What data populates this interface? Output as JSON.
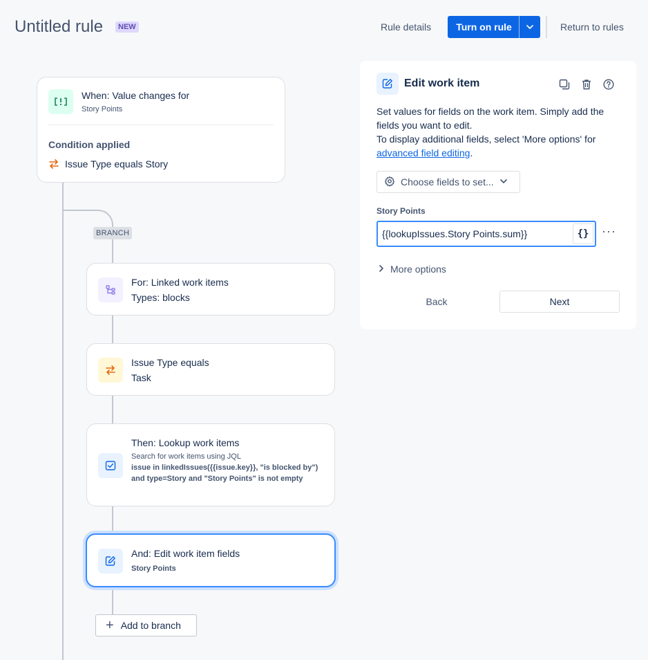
{
  "header": {
    "title": "Untitled rule",
    "badge": "NEW",
    "rule_details": "Rule details",
    "turn_on": "Turn on rule",
    "return": "Return to rules"
  },
  "trigger": {
    "title": "When: Value changes for",
    "subtitle": "Story Points",
    "condition_heading": "Condition applied",
    "condition_text": "Issue Type equals Story"
  },
  "branch_tag": "BRANCH",
  "steps": [
    {
      "title": "For: Linked work items",
      "subtitle": "Types: blocks",
      "icon": "branch-icon"
    },
    {
      "title": "Issue Type equals",
      "subtitle": "Task",
      "icon": "swap-icon"
    },
    {
      "title": "Then: Lookup work items",
      "subtitle": "Search for work items using JQL",
      "detail": "issue in linkedIssues({{issue.key}}, \"is blocked by\") and type=Story and \"Story Points\" is not empty",
      "icon": "lookup-icon"
    },
    {
      "title": "And: Edit work item fields",
      "subtitle": "Story Points",
      "icon": "edit-icon"
    }
  ],
  "add_branch": "Add to branch",
  "panel": {
    "title": "Edit work item",
    "desc1": "Set values for fields on the work item. Simply add the fields you want to edit.",
    "desc2": "To display additional fields, select 'More options' for",
    "link": "advanced field editing",
    "desc_end": ".",
    "choose_fields": "Choose fields to set...",
    "field_label": "Story Points",
    "field_value": "{{lookupIssues.Story Points.sum}}",
    "braces": "{}",
    "dots": "···",
    "more_options": "More options",
    "back": "Back",
    "next": "Next"
  },
  "colors": {
    "primary": "#0c66e4",
    "selected_border": "#388bff",
    "trigger_icon_bg": "#dcfff1",
    "branch_icon_bg": "#f3f0ff",
    "condition_icon_bg": "#fff7d6",
    "action_icon_bg": "#e9f2ff"
  }
}
